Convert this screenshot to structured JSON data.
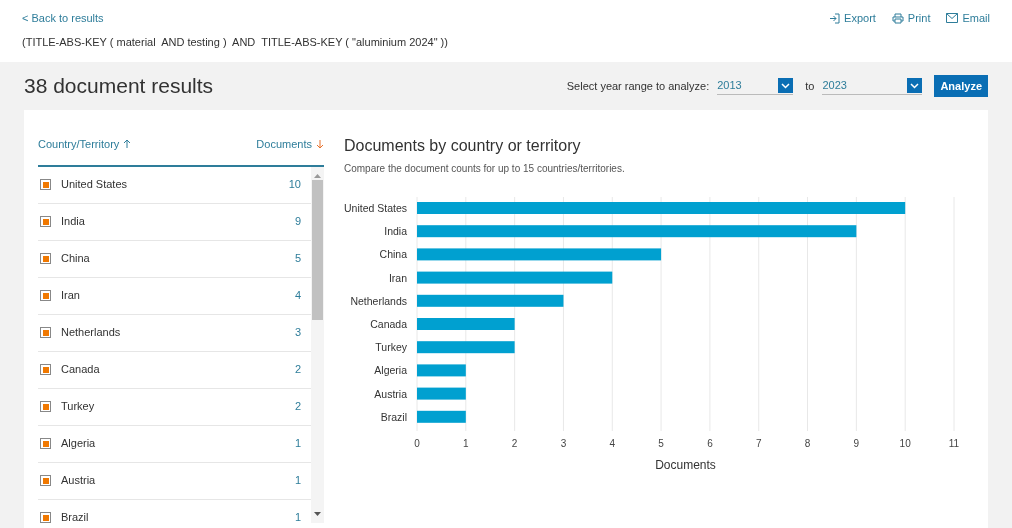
{
  "back_link": "< Back to results",
  "actions": [
    {
      "kind": "export",
      "label": "Export"
    },
    {
      "kind": "print",
      "label": "Print"
    },
    {
      "kind": "email",
      "label": "Email"
    }
  ],
  "query": "(TITLE-ABS-KEY ( material  AND testing )  AND  TITLE-ABS-KEY ( \"aluminium 2024\" ))",
  "results_title": "38 document results",
  "year_range": {
    "label": "Select year range to analyze:",
    "from": "2013",
    "to_label": "to",
    "to": "2023",
    "button": "Analyze"
  },
  "table": {
    "columns": [
      "Country/Territory",
      "Documents"
    ],
    "rows": [
      {
        "name": "United States",
        "count": "10",
        "checked": true
      },
      {
        "name": "India",
        "count": "9",
        "checked": true
      },
      {
        "name": "China",
        "count": "5",
        "checked": true
      },
      {
        "name": "Iran",
        "count": "4",
        "checked": true
      },
      {
        "name": "Netherlands",
        "count": "3",
        "checked": true
      },
      {
        "name": "Canada",
        "count": "2",
        "checked": true
      },
      {
        "name": "Turkey",
        "count": "2",
        "checked": true
      },
      {
        "name": "Algeria",
        "count": "1",
        "checked": true
      },
      {
        "name": "Austria",
        "count": "1",
        "checked": true
      },
      {
        "name": "Brazil",
        "count": "1",
        "checked": true
      }
    ]
  },
  "chart": {
    "title": "Documents by country or territory",
    "subtitle": "Compare the document counts for up to 15 countries/territories.",
    "chart_data": {
      "type": "bar",
      "orientation": "horizontal",
      "xlabel": "Documents",
      "categories": [
        "United States",
        "India",
        "China",
        "Iran",
        "Netherlands",
        "Canada",
        "Turkey",
        "Algeria",
        "Austria",
        "Brazil"
      ],
      "grid": true,
      "series": [
        {
          "color": "#00a0d0",
          "values": [
            10,
            9,
            5,
            4,
            3,
            2,
            2,
            1,
            1,
            1
          ]
        }
      ],
      "xlim": [
        0,
        11
      ],
      "xticks": [
        0,
        1,
        2,
        3,
        4,
        5,
        6,
        7,
        8,
        9,
        10,
        11
      ]
    }
  }
}
